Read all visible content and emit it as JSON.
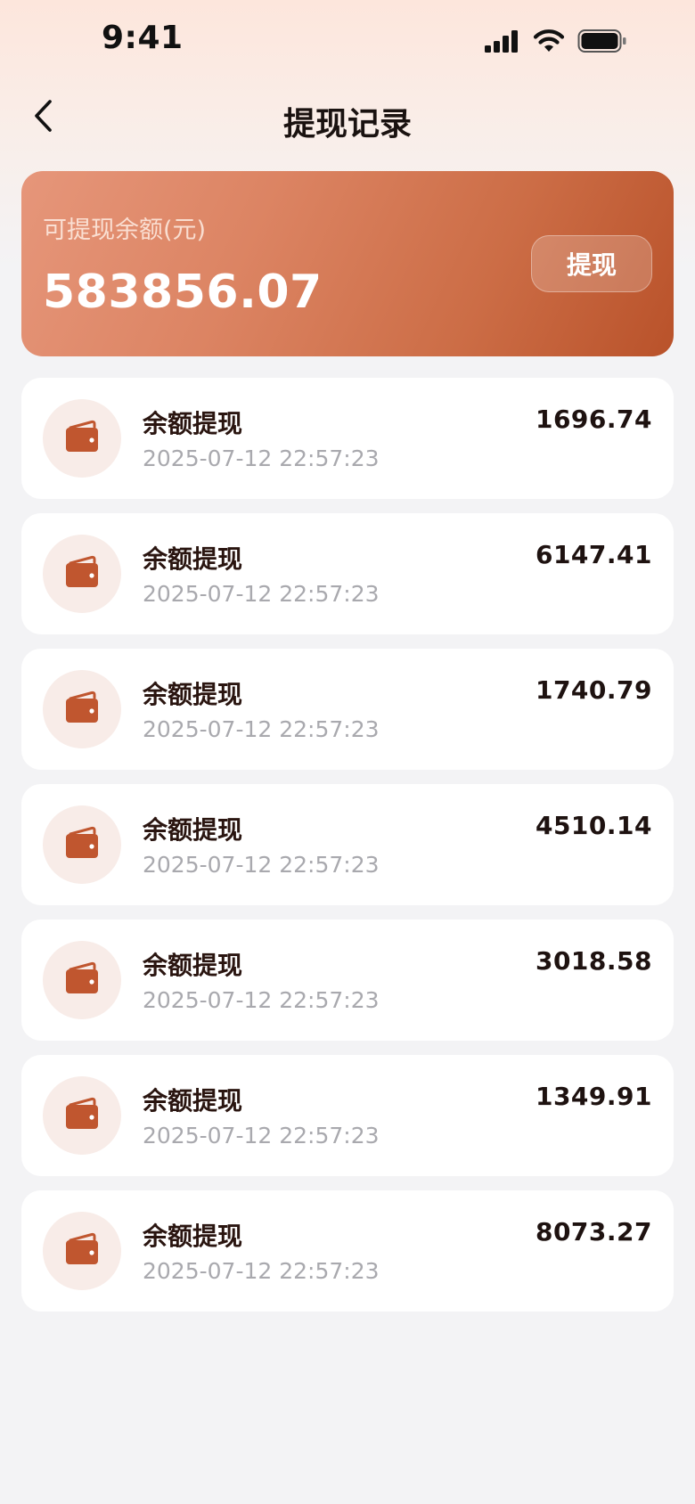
{
  "status_bar": {
    "time": "9:41",
    "icons": [
      "signal-icon",
      "wifi-icon",
      "battery-icon"
    ]
  },
  "nav": {
    "back_icon": "chevron-left-icon",
    "title": "提现记录"
  },
  "balance": {
    "label": "可提现余额(元)",
    "amount": "583856.07",
    "withdraw_label": "提现"
  },
  "colors": {
    "accent": "#c0562f",
    "icon_bg": "#f8ece8"
  },
  "records": [
    {
      "icon": "wallet-icon",
      "title": "余额提现",
      "time": "2025-07-12 22:57:23",
      "amount": "1696.74"
    },
    {
      "icon": "wallet-icon",
      "title": "余额提现",
      "time": "2025-07-12 22:57:23",
      "amount": "6147.41"
    },
    {
      "icon": "wallet-icon",
      "title": "余额提现",
      "time": "2025-07-12 22:57:23",
      "amount": "1740.79"
    },
    {
      "icon": "wallet-icon",
      "title": "余额提现",
      "time": "2025-07-12 22:57:23",
      "amount": "4510.14"
    },
    {
      "icon": "wallet-icon",
      "title": "余额提现",
      "time": "2025-07-12 22:57:23",
      "amount": "3018.58"
    },
    {
      "icon": "wallet-icon",
      "title": "余额提现",
      "time": "2025-07-12 22:57:23",
      "amount": "1349.91"
    },
    {
      "icon": "wallet-icon",
      "title": "余额提现",
      "time": "2025-07-12 22:57:23",
      "amount": "8073.27"
    }
  ]
}
